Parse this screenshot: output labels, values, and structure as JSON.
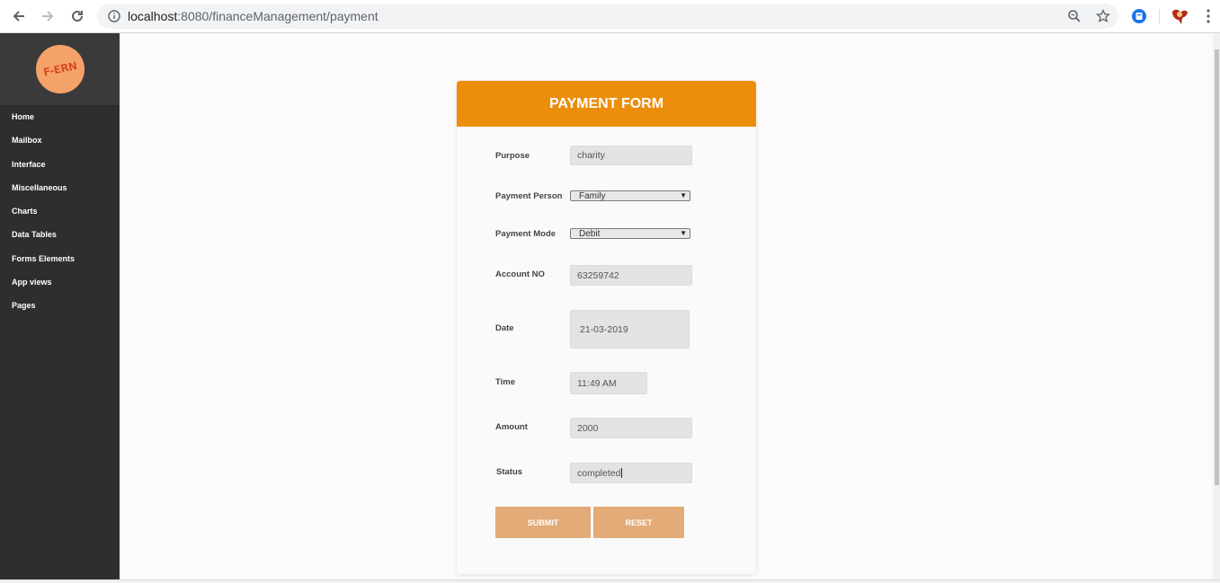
{
  "browser": {
    "url_host": "localhost",
    "url_rest": ":8080/financeManagement/payment"
  },
  "sidebar": {
    "logo_text": "F-ERN",
    "items": [
      {
        "label": "Home"
      },
      {
        "label": "Mailbox"
      },
      {
        "label": "Interface"
      },
      {
        "label": "Miscellaneous"
      },
      {
        "label": "Charts"
      },
      {
        "label": "Data Tables"
      },
      {
        "label": "Forms Elements"
      },
      {
        "label": "App views"
      },
      {
        "label": "Pages"
      }
    ]
  },
  "form": {
    "title": "PAYMENT FORM",
    "purpose": {
      "label": "Purpose",
      "value": "charity"
    },
    "payment_person": {
      "label": "Payment Person",
      "value": "Family"
    },
    "payment_mode": {
      "label": "Payment Mode",
      "value": "Debit"
    },
    "account_no": {
      "label": "Account NO",
      "value": "63259742"
    },
    "date": {
      "label": "Date",
      "value": "21-03-2019"
    },
    "time": {
      "label": "Time",
      "value": "11:49 AM"
    },
    "amount": {
      "label": "Amount",
      "value": "2000"
    },
    "status": {
      "label": "Status",
      "value": "completed"
    },
    "submit_label": "SUBMIT",
    "reset_label": "RESET"
  },
  "colors": {
    "header_orange": "#ec8e0b",
    "button_tan": "#e2ab78",
    "sidebar_bg": "#2e2e2e"
  }
}
